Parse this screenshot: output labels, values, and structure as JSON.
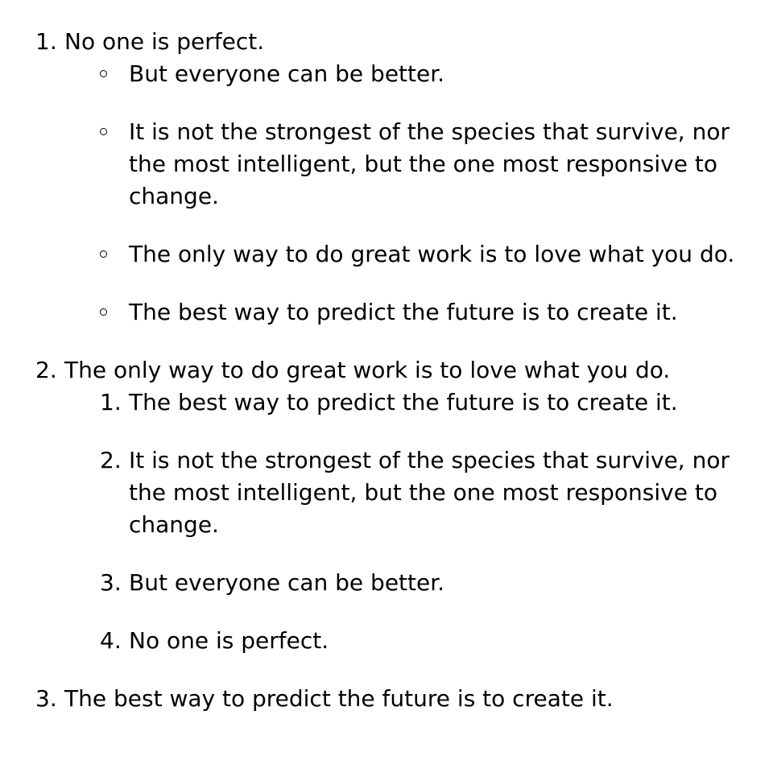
{
  "list": {
    "items": [
      {
        "marker": "1.",
        "text": "No one is perfect.",
        "children": [
          {
            "text": "But everyone can be better."
          },
          {
            "text": "It is not the strongest of the species that survive, nor the most intelligent, but the one most responsive to change."
          },
          {
            "text": "The only way to do great work is to love what you do."
          },
          {
            "text": "The best way to predict the future is to create it."
          }
        ]
      },
      {
        "marker": "2.",
        "text": "The only way to do great work is to love what you do.",
        "children": [
          {
            "marker": "1.",
            "text": "The best way to predict the future is to create it."
          },
          {
            "marker": "2.",
            "text": "It is not the strongest of the species that survive, nor the most intelligent, but the one most responsive to change."
          },
          {
            "marker": "3.",
            "text": "But everyone can be better."
          },
          {
            "marker": "4.",
            "text": "No one is perfect."
          }
        ]
      },
      {
        "marker": "3.",
        "text": "The best way to predict the future is to create it."
      }
    ]
  }
}
